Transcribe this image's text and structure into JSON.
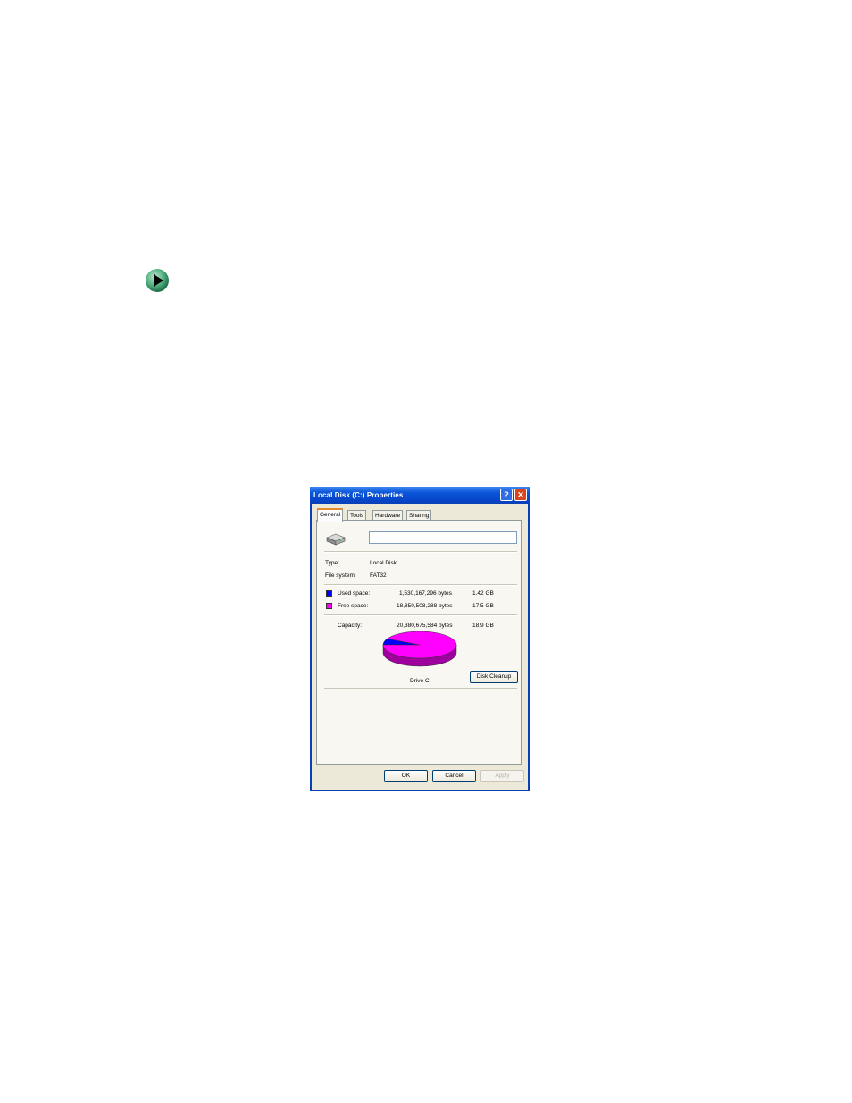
{
  "dialog": {
    "title": "Local Disk (C:) Properties",
    "help_glyph": "?",
    "close_glyph": "✕"
  },
  "tabs": [
    {
      "label": "General",
      "active": true
    },
    {
      "label": "Tools",
      "active": false
    },
    {
      "label": "Hardware",
      "active": false
    },
    {
      "label": "Sharing",
      "active": false
    }
  ],
  "general": {
    "volume_label_value": "",
    "type_label": "Type:",
    "type_value": "Local Disk",
    "fs_label": "File system:",
    "fs_value": "FAT32",
    "used_label": "Used space:",
    "used_bytes": "1,530,167,296 bytes",
    "used_gb": "1.42 GB",
    "free_label": "Free space:",
    "free_bytes": "18,850,508,288 bytes",
    "free_gb": "17.5 GB",
    "capacity_label": "Capacity:",
    "capacity_bytes": "20,380,675,584 bytes",
    "capacity_gb": "18.9 GB",
    "drive_caption": "Drive C",
    "cleanup_label": "Disk Cleanup"
  },
  "chart_data": {
    "type": "pie",
    "slices": [
      {
        "label": "Used space",
        "value": 1.42,
        "color": "#0000ff"
      },
      {
        "label": "Free space",
        "value": 17.5,
        "color": "#ff00ff"
      }
    ]
  },
  "buttons": {
    "ok": "OK",
    "cancel": "Cancel",
    "apply": "Apply"
  },
  "colors": {
    "used": "#0000ff",
    "free": "#ff00ff",
    "title_bar": "#0a55d8"
  },
  "icons": {
    "bullet": "green-arrow-bullet-icon",
    "drive": "hard-drive-icon"
  }
}
